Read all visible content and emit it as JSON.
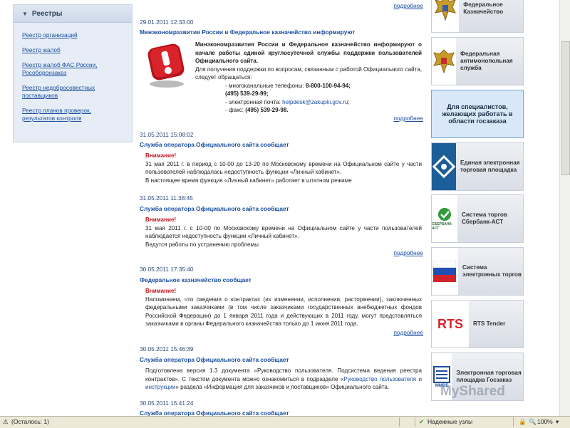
{
  "sidebar": {
    "title": "Реестры",
    "items": [
      {
        "label": "Реестр организаций"
      },
      {
        "label": "Реестр жалоб"
      },
      {
        "label": "Реестр жалоб ФАС России, Рособоронзаказ"
      },
      {
        "label": "Реестр недобросовестных поставщиков"
      },
      {
        "label": "Реестр планов проверок, результатов контроля"
      }
    ]
  },
  "news": {
    "more_label": "подробнее",
    "items": [
      {
        "date": "29.01.2011 12:33:00",
        "headline": "Минэкономразвития России и Федеральное казначейство информируют",
        "body_intro": "Минэкономразвития России и Федеральное казначейство информируют о начале работы единой круглосуточной службы поддержки пользователей Официального сайта.",
        "body_text": "Для получения поддержки по вопросам, связанным с работой Официального сайта, следует обращаться:",
        "contacts": [
          {
            "label": "- многоканальные телефоны:",
            "value": "8-800-100-94-94;"
          },
          {
            "label": "",
            "value": "(495) 539-29-99;"
          },
          {
            "label": "- электронная почта:",
            "value": "helpdesk@zakupki.gov.ru",
            "suffix": ";"
          },
          {
            "label": "- факс:",
            "value": "(495) 539-29-98."
          }
        ]
      },
      {
        "date": "31.05.2011 15:08:02",
        "headline": "Служба оператора Официального сайта сообщает",
        "warning": "Внимание!",
        "body": "31 мая 2011 г. в период с 10-00 до 13-20 по Московскому времени на Официальном сайте у части пользователей наблюдалась недоступность функции «Личный кабинет».",
        "body2": "В настоящее время функция «Личный кабинет» работает в штатном режиме"
      },
      {
        "date": "31.05.2011 11:38:45",
        "headline": "Служба оператора Официального сайта сообщает",
        "warning": "Внимание!",
        "body": "31 мая 2011 г. с 10-00 по Московскому времени на Официальном сайте у части пользователей наблюдается недоступность функции «Личный кабинет».",
        "body2": "Ведутся работы по устранению проблемы"
      },
      {
        "date": "30.05.2011 17:35:40",
        "headline": "Федеральное казначейство сообщает",
        "warning": "Внимание!",
        "body": "Напоминаем, что сведения о контрактах (их изменении, исполнении, расторжении), заключенных федеральными заказчиками (в том числе заказчиками государственных внебюджетных фондов Российской Федерации) до 1 января 2011 года и действующих в 2011 году, могут представляться заказчиками в органы Федерального казначейства только до 1 июня 2011 года."
      },
      {
        "date": "30.05.2011 15:46:39",
        "headline": "Служба оператора Официального сайта сообщает",
        "body_a": "Подготовлена версия 1.3 документа «Руководство пользователя. Подсистема ведения реестра контрактов». С текстом документа можно ознакомиться в подразделе «",
        "link": "Руководство пользователя и инструкции",
        "body_b": "» раздела «Информация для заказчиков и поставщиков» Официального сайта."
      },
      {
        "date": "30.05.2011 15:41:24",
        "headline": "Служба оператора Официального сайта сообщает"
      }
    ]
  },
  "banners": [
    {
      "text": "Федеральное Казначейство",
      "icon": "eagle-emblem-icon"
    },
    {
      "text": "Федеральная антимонопольная служба",
      "icon": "eagle-emblem-icon"
    },
    {
      "text": "Для специалистов, желающих работать в области госзаказа",
      "icon": ""
    },
    {
      "text": "Единая электронная торговая площадка",
      "icon": "etp-logo-icon"
    },
    {
      "text": "Система торгов Сбербанк-АСТ",
      "icon": "sberbank-ast-logo",
      "logo_text": "СБЕРБАНК-АСТ"
    },
    {
      "text": "Система электронных торгов",
      "icon": "russian-flag-icon"
    },
    {
      "text": "RTS Tender",
      "icon": "rts-logo",
      "logo_text": "RTS"
    },
    {
      "text": "Электронная торговая площадка Госзаказ",
      "icon": "micex-logo-icon",
      "logo_text": "ММВБ"
    }
  ],
  "status_bar": {
    "done_text": "(Осталось: 1)",
    "zone_text": "Надежные узлы",
    "zoom": "100%"
  },
  "watermark": "MyShared",
  "colors": {
    "link": "#1a4fa0",
    "warning": "#c0181f",
    "sidebar_bg": "#e6edf6",
    "blue_banner": "#d8e8f8"
  }
}
